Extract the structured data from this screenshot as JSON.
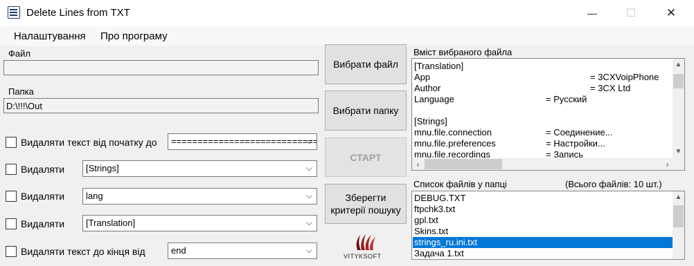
{
  "window": {
    "title": "Delete Lines from TXT",
    "minimize_glyph": "—",
    "maximize_glyph": "☐",
    "close_glyph": "✕"
  },
  "menu": [
    "Налаштування",
    "Про програму"
  ],
  "file": {
    "label": "Файл",
    "value": ""
  },
  "folder": {
    "label": "Папка",
    "value": "D:\\!!!\\Out"
  },
  "options": [
    {
      "label": "Видаляти текст від початку до",
      "checked": false,
      "value": "============================="
    },
    {
      "label": "Видаляти",
      "checked": false,
      "value": "[Strings]"
    },
    {
      "label": "Видаляти",
      "checked": false,
      "value": "lang"
    },
    {
      "label": "Видаляти",
      "checked": false,
      "value": "[Translation]"
    },
    {
      "label": "Видаляти текст до кінця від",
      "checked": false,
      "value": "end"
    }
  ],
  "buttons": {
    "choose_file": "Вибрати файл",
    "choose_folder": "Вибрати папку",
    "start": "СТАРТ",
    "save_line1": "Зберегти",
    "save_line2": "критерії пошуку"
  },
  "logo": {
    "text": "VITYKSOFT",
    "color": "#8b1a1a"
  },
  "content": {
    "title": "Вміст вибраного файла",
    "lines": [
      {
        "key": "[Translation]",
        "value": ""
      },
      {
        "key": "App",
        "value": "= 3CXVoipPhone"
      },
      {
        "key": "Author",
        "value": "= 3CX Ltd"
      },
      {
        "key": "Language",
        "value": "= Русский"
      },
      {
        "key": "",
        "value": ""
      },
      {
        "key": "[Strings]",
        "value": ""
      },
      {
        "key": "mnu.file.connection",
        "value": "= Соединение..."
      },
      {
        "key": "mnu.file.preferences",
        "value": "= Настройки..."
      },
      {
        "key": "mnu.file.recordings",
        "value": "= Запись"
      }
    ]
  },
  "filelist": {
    "title": "Список файлів у папці",
    "count": "(Всього файлів: 10 шт.)",
    "items": [
      "DEBUG.TXT",
      "ftpchk3.txt",
      "gpl.txt",
      "Skins.txt",
      "strings_ru.ini.txt",
      "Задача 1.txt"
    ],
    "selected_index": 4
  },
  "colors": {
    "selection": "#0078d7",
    "window_bg": "#f0f0f0"
  }
}
